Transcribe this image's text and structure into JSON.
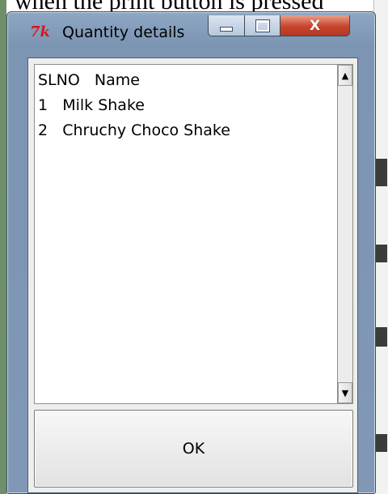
{
  "backdrop": {
    "caption": "when the print button is pressed"
  },
  "window": {
    "title": "Quantity details",
    "icon": "tk-feather-icon",
    "icon_text": "7k",
    "controls": {
      "minimize": "minimize-icon",
      "maximize": "maximize-icon",
      "close_label": "X"
    }
  },
  "list": {
    "header": "SLNO   Name",
    "items": [
      "1   Milk Shake",
      "2   Chruchy Choco Shake"
    ]
  },
  "scrollbar": {
    "up_icon": "scroll-up-arrow-icon",
    "down_icon": "scroll-down-arrow-icon",
    "up_glyph": "▲",
    "down_glyph": "▼"
  },
  "ok_button": {
    "label": "OK"
  }
}
